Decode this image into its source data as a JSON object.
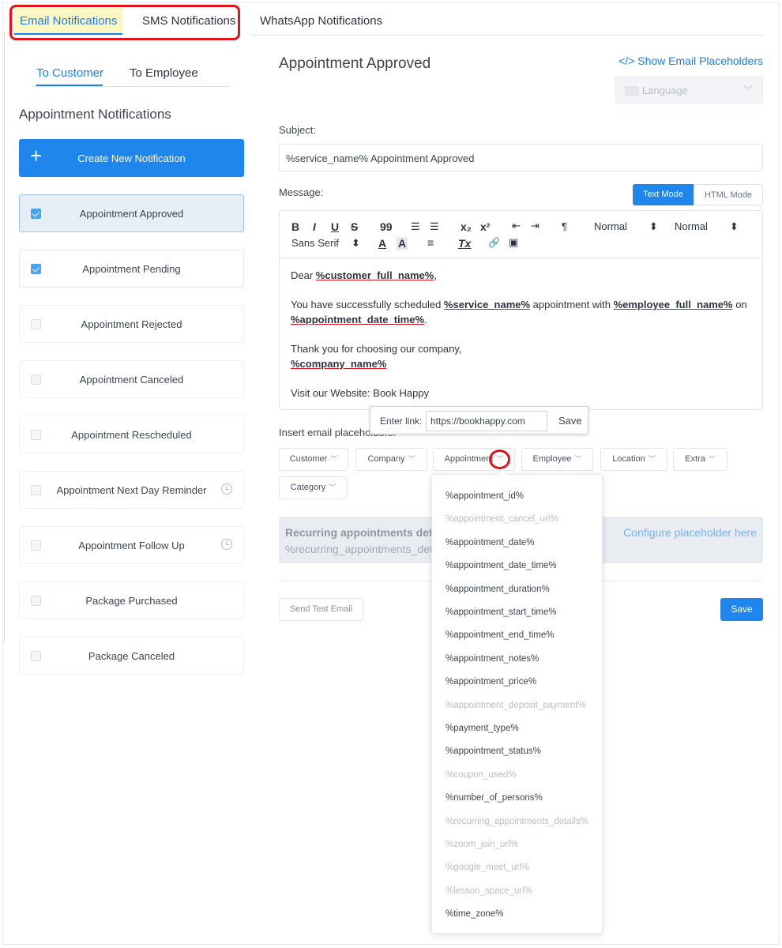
{
  "top_tabs": {
    "email": "Email Notifications",
    "sms": "SMS Notifications",
    "whatsapp": "WhatsApp Notifications"
  },
  "sub_tabs": {
    "customer": "To Customer",
    "employee": "To Employee"
  },
  "sidebar": {
    "title": "Appointment Notifications",
    "create_label": "Create New Notification",
    "items": [
      {
        "label": "Appointment Approved",
        "checked": true,
        "active": true
      },
      {
        "label": "Appointment Pending",
        "checked": true
      },
      {
        "label": "Appointment Rejected",
        "checked": false
      },
      {
        "label": "Appointment Canceled",
        "checked": false
      },
      {
        "label": "Appointment Rescheduled",
        "checked": false
      },
      {
        "label": "Appointment Next Day Reminder",
        "checked": false,
        "timer": true
      },
      {
        "label": "Appointment Follow Up",
        "checked": false,
        "timer": true
      },
      {
        "label": "Package Purchased",
        "checked": false
      },
      {
        "label": "Package Canceled",
        "checked": false
      }
    ]
  },
  "panel": {
    "title": "Appointment Approved",
    "show_placeholders": "</> Show Email Placeholders",
    "language_placeholder": "Language",
    "subject_label": "Subject:",
    "subject_value": "%service_name% Appointment Approved",
    "message_label": "Message:",
    "text_mode": "Text Mode",
    "html_mode": "HTML Mode"
  },
  "toolbar": {
    "bold": "B",
    "italic": "I",
    "underline": "U",
    "strike": "S",
    "quote": "99",
    "ol": "☰",
    "ul": "☰",
    "sub": "x₂",
    "sup": "x²",
    "outdent": "⇤",
    "indent": "⇥",
    "rtl": "¶",
    "size1": "Normal",
    "size2": "Normal",
    "font": "Sans Serif",
    "color": "A",
    "bg": "A",
    "align": "≡",
    "clear": "Tx",
    "link": "🔗",
    "image": "▣"
  },
  "message": {
    "dear": "Dear ",
    "customer_ph": "%customer_full_name%",
    "dear_end": ",",
    "l2a": "You have successfully scheduled ",
    "service_ph": "%service_name%",
    "l2b": " appointment with ",
    "employee_ph": "%employee_full_name%",
    "l2c": " on",
    "date_ph": "%appointment_date_time%",
    "l2d": ".",
    "l3": "Thank you for choosing our company,",
    "company_ph": "%company_name%",
    "l4": "Visit our Website: Book Happy"
  },
  "link_popup": {
    "label": "Enter link:",
    "value": "https://bookhappy.com",
    "save": "Save"
  },
  "insert": {
    "label": "Insert email placeholders:",
    "dropdowns": [
      "Customer",
      "Company",
      "Appointment",
      "Employee",
      "Location",
      "Extra",
      "Category"
    ]
  },
  "recurring": {
    "title": "Recurring appointments details",
    "placeholder": "%recurring_appointments_details%",
    "configure": "Configure placeholder here"
  },
  "footer": {
    "test": "Send Test Email",
    "save": "Save"
  },
  "appointment_menu": [
    {
      "label": "%appointment_id%",
      "disabled": false
    },
    {
      "label": "%appointment_cancel_url%",
      "disabled": true
    },
    {
      "label": "%appointment_date%",
      "disabled": false
    },
    {
      "label": "%appointment_date_time%",
      "disabled": false
    },
    {
      "label": "%appointment_duration%",
      "disabled": false
    },
    {
      "label": "%appointment_start_time%",
      "disabled": false
    },
    {
      "label": "%appointment_end_time%",
      "disabled": false
    },
    {
      "label": "%appointment_notes%",
      "disabled": false
    },
    {
      "label": "%appointment_price%",
      "disabled": false
    },
    {
      "label": "%appointment_deposit_payment%",
      "disabled": true
    },
    {
      "label": "%payment_type%",
      "disabled": false
    },
    {
      "label": "%appointment_status%",
      "disabled": false
    },
    {
      "label": "%coupon_used%",
      "disabled": true
    },
    {
      "label": "%number_of_persons%",
      "disabled": false
    },
    {
      "label": "%recurring_appointments_details%",
      "disabled": true
    },
    {
      "label": "%zoom_join_url%",
      "disabled": true
    },
    {
      "label": "%google_meet_url%",
      "disabled": true
    },
    {
      "label": "%lesson_space_url%",
      "disabled": true
    },
    {
      "label": "%time_zone%",
      "disabled": false
    }
  ],
  "colors": {
    "accent": "#1f86ee",
    "highlight_ring": "#e3121b",
    "active_tab_bg": "#fdf7c3"
  }
}
